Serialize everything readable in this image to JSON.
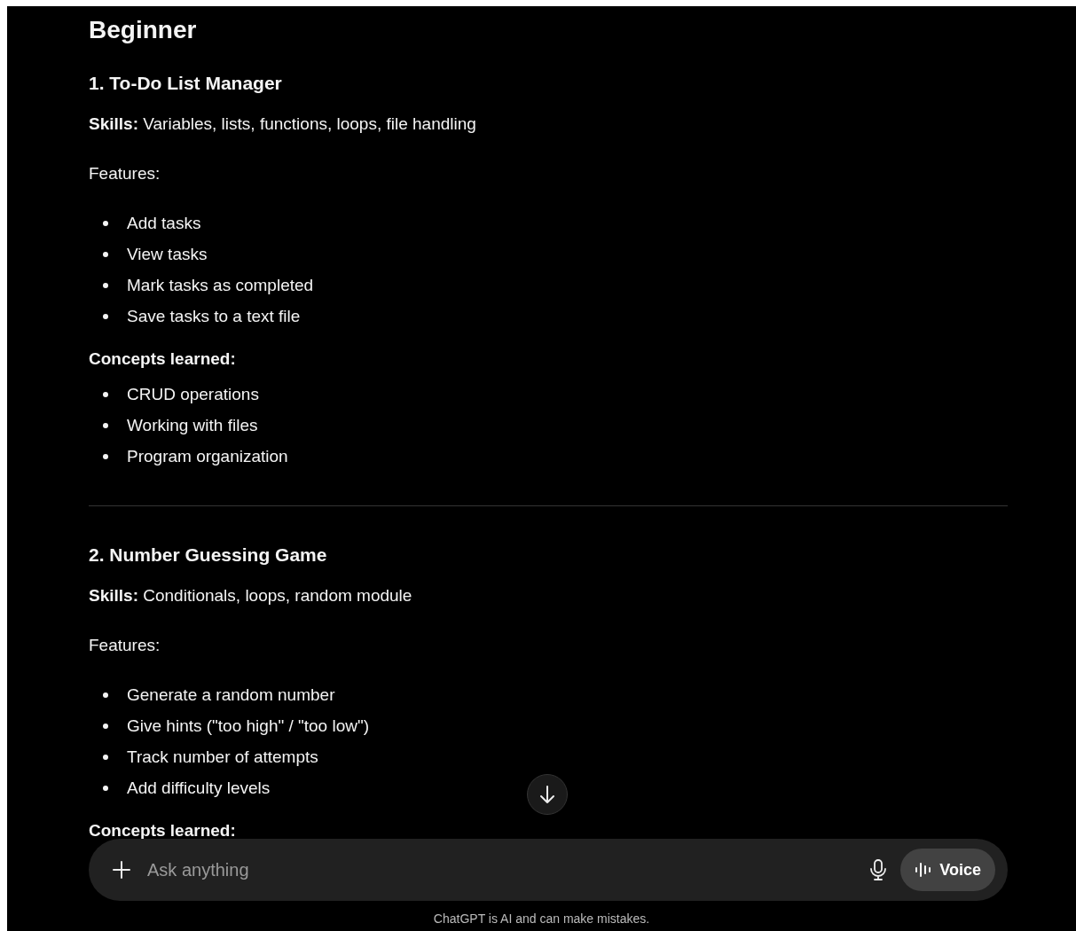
{
  "heading": "Beginner",
  "projects": [
    {
      "title": "1. To-Do List Manager",
      "skills": "**Skills:** Variables, lists, functions, loops, file handling",
      "features_label": "Features:",
      "features": [
        "Add tasks",
        "View tasks",
        "Mark tasks as completed",
        "Save tasks to a text file"
      ],
      "concepts_label": "Concepts learned:",
      "concepts": [
        "CRUD operations",
        "Working with files",
        "Program organization"
      ]
    },
    {
      "title": "2. Number Guessing Game",
      "skills": "**Skills:** Conditionals, loops, random module",
      "features_label": "Features:",
      "features": [
        "Generate a random number",
        "Give hints (\"too high\" / \"too low\")",
        "Track number of attempts",
        "Add difficulty levels"
      ],
      "concepts_label": "Concepts learned:"
    }
  ],
  "composer": {
    "placeholder": "Ask anything",
    "voice_button": "Voice"
  },
  "disclaimer": "ChatGPT is AI and can make mistakes."
}
